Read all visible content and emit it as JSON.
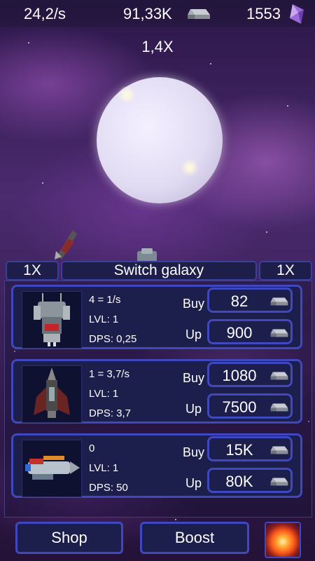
{
  "hud": {
    "rate": "24,2/s",
    "metal": "91,33K",
    "gems": "1553",
    "multiplier": "1,4X"
  },
  "galaxy": {
    "left_mult": "1X",
    "switch_label": "Switch galaxy",
    "right_mult": "1X"
  },
  "ships": [
    {
      "count": "4 = 1/s",
      "level": "LVL: 1",
      "dps": "DPS: 0,25",
      "buy_label": "Buy",
      "buy_price": "82",
      "up_label": "Up",
      "up_price": "900"
    },
    {
      "count": "1 = 3,7/s",
      "level": "LVL: 1",
      "dps": "DPS: 3,7",
      "buy_label": "Buy",
      "buy_price": "1080",
      "up_label": "Up",
      "up_price": "7500"
    },
    {
      "count": "0",
      "level": "LVL: 1",
      "dps": "DPS: 50",
      "buy_label": "Buy",
      "buy_price": "15K",
      "up_label": "Up",
      "up_price": "80K"
    }
  ],
  "bottom": {
    "shop": "Shop",
    "boost": "Boost"
  },
  "icons": {
    "metal": "metal-ingot-icon",
    "gem": "crystal-gem-icon",
    "boost": "fire-orb-icon"
  },
  "colors": {
    "accent": "#4048c0",
    "panel": "#1c1e4c"
  }
}
